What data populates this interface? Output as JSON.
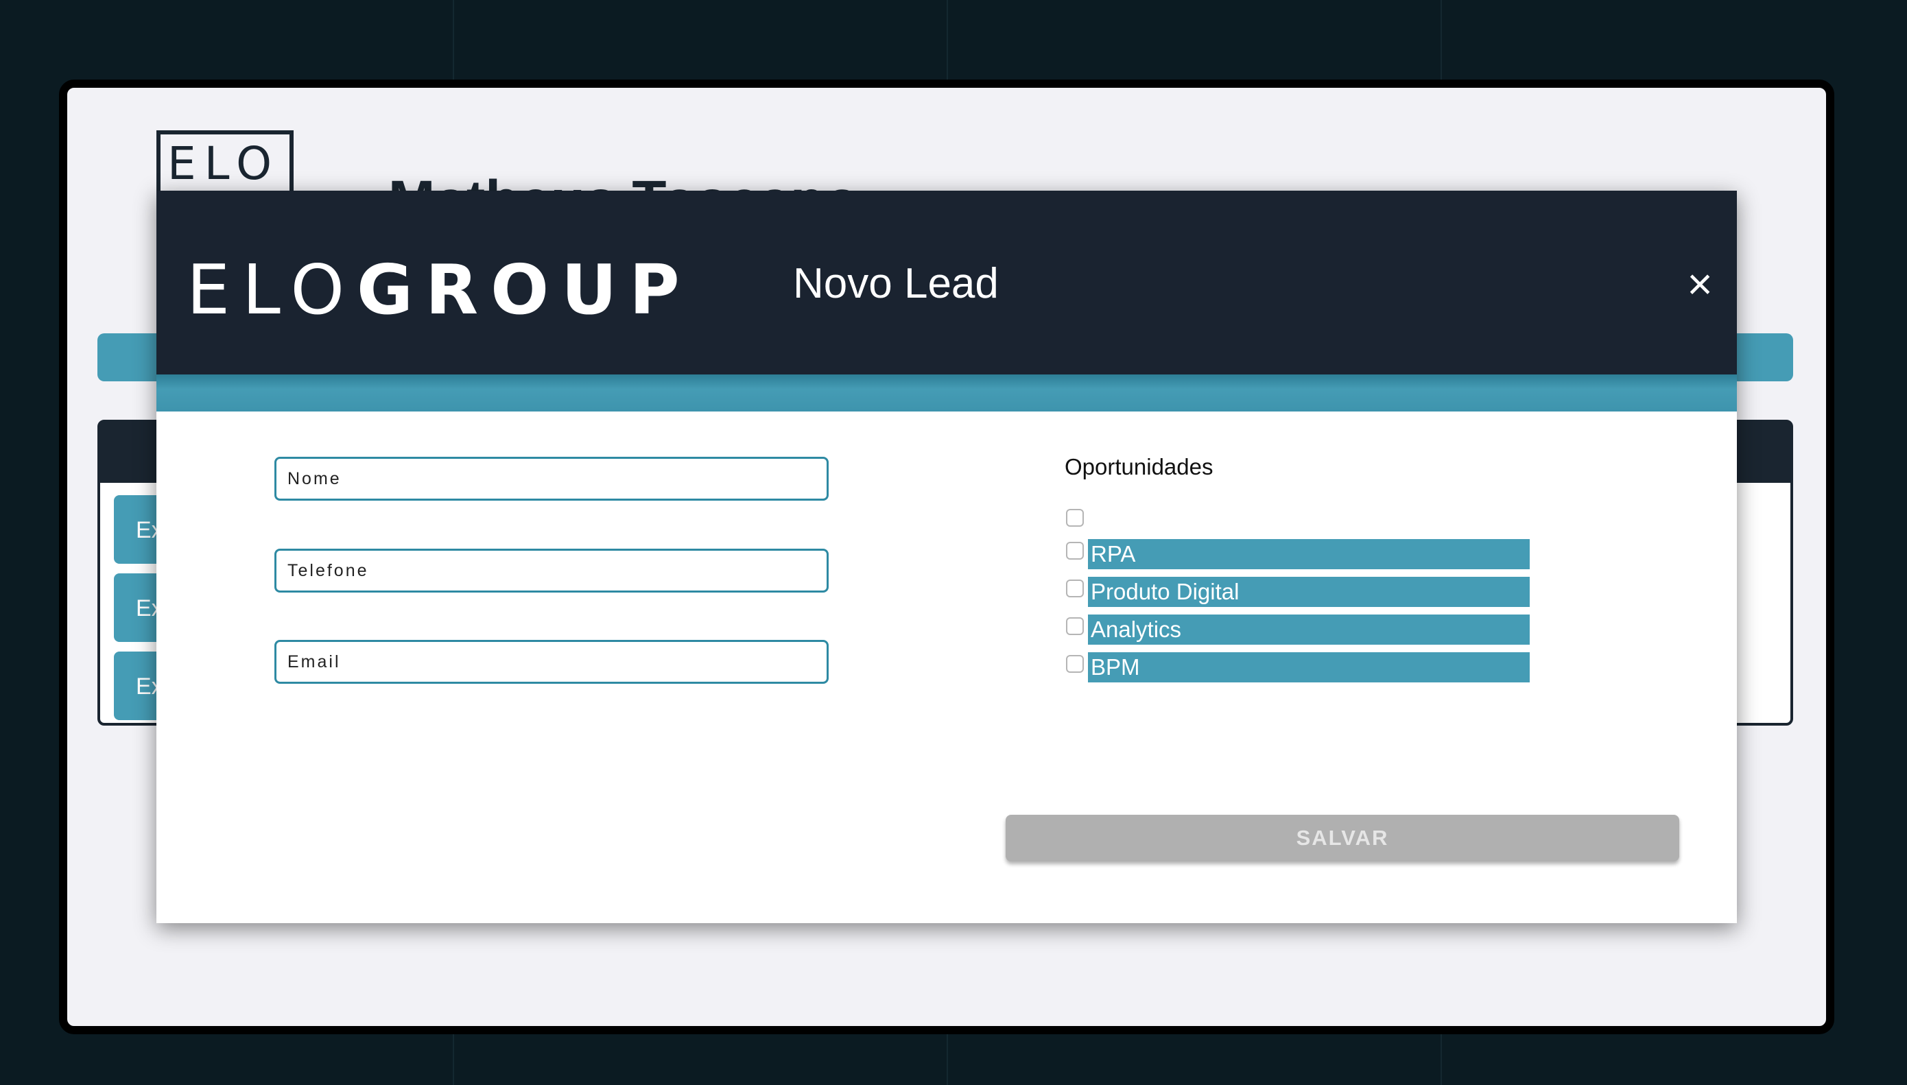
{
  "background": {
    "logo_text": "ELO",
    "user_name": "Matheus Toscano",
    "chips": [
      "Ex",
      "Ex",
      "Ex"
    ]
  },
  "modal": {
    "brand_thin": "ELO",
    "brand_bold": "GROUP",
    "title": "Novo Lead",
    "close_symbol": "×",
    "fields": {
      "name_placeholder": "Nome",
      "phone_placeholder": "Telefone",
      "email_placeholder": "Email"
    },
    "opportunities": {
      "title": "Oportunidades",
      "items": [
        {
          "label": "RPA",
          "checked": false
        },
        {
          "label": "Produto Digital",
          "checked": false
        },
        {
          "label": "Analytics",
          "checked": false
        },
        {
          "label": "BPM",
          "checked": false
        }
      ]
    },
    "save_label": "SALVAR"
  },
  "colors": {
    "page_bg": "#0b1b22",
    "header_bg": "#1a2330",
    "accent": "#459cb5",
    "disabled_button": "#b0b0b0"
  }
}
